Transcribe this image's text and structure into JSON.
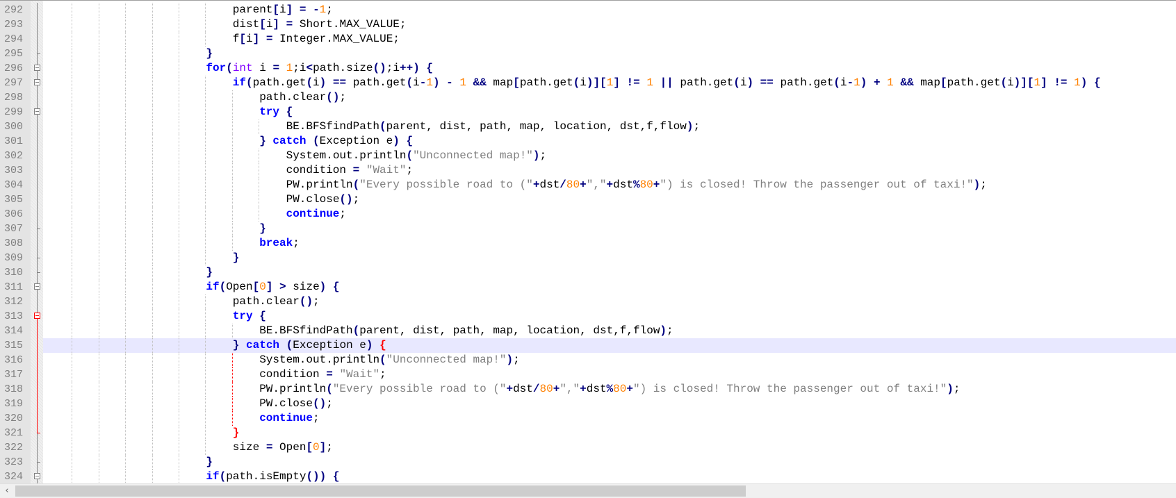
{
  "editor": {
    "current_line": 315,
    "lines": [
      {
        "num": "292",
        "indent": 28,
        "text": "parent[i] = -1;"
      },
      {
        "num": "293",
        "indent": 28,
        "text": "dist[i] = Short.MAX_VALUE;"
      },
      {
        "num": "294",
        "indent": 28,
        "text": "f[i] = Integer.MAX_VALUE;"
      },
      {
        "num": "295",
        "indent": 24,
        "text": "}",
        "fold": "end"
      },
      {
        "num": "296",
        "indent": 24,
        "text": "for(int i = 1;i<path.size();i++) {",
        "fold": "box"
      },
      {
        "num": "297",
        "indent": 28,
        "text": "if(path.get(i) == path.get(i-1) - 1 && map[path.get(i)][1] != 1 || path.get(i) == path.get(i-1) + 1 && map[path.get(i)][1] != 1) {",
        "fold": "box"
      },
      {
        "num": "298",
        "indent": 32,
        "text": "path.clear();"
      },
      {
        "num": "299",
        "indent": 32,
        "text": "try {",
        "fold": "box"
      },
      {
        "num": "300",
        "indent": 36,
        "text": "BE.BFSfindPath(parent, dist, path, map, location, dst,f,flow);"
      },
      {
        "num": "301",
        "indent": 32,
        "text": "} catch (Exception e) {"
      },
      {
        "num": "302",
        "indent": 36,
        "text": "System.out.println(\"Unconnected map!\");"
      },
      {
        "num": "303",
        "indent": 36,
        "text": "condition = \"Wait\";"
      },
      {
        "num": "304",
        "indent": 36,
        "text": "PW.println(\"Every possible road to (\"+dst/80+\",\"+dst%80+\") is closed! Throw the passenger out of taxi!\");"
      },
      {
        "num": "305",
        "indent": 36,
        "text": "PW.close();"
      },
      {
        "num": "306",
        "indent": 36,
        "text": "continue;"
      },
      {
        "num": "307",
        "indent": 32,
        "text": "}",
        "fold": "end"
      },
      {
        "num": "308",
        "indent": 32,
        "text": "break;"
      },
      {
        "num": "309",
        "indent": 28,
        "text": "}",
        "fold": "end"
      },
      {
        "num": "310",
        "indent": 24,
        "text": "}",
        "fold": "end"
      },
      {
        "num": "311",
        "indent": 24,
        "text": "if(Open[0] > size) {",
        "fold": "box"
      },
      {
        "num": "312",
        "indent": 28,
        "text": "path.clear();"
      },
      {
        "num": "313",
        "indent": 28,
        "text": "try {",
        "fold": "box-red"
      },
      {
        "num": "314",
        "indent": 32,
        "text": "BE.BFSfindPath(parent, dist, path, map, location, dst,f,flow);"
      },
      {
        "num": "315",
        "indent": 28,
        "text": "} catch (Exception e) {",
        "match": "last"
      },
      {
        "num": "316",
        "indent": 32,
        "text": "System.out.println(\"Unconnected map!\");"
      },
      {
        "num": "317",
        "indent": 32,
        "text": "condition = \"Wait\";"
      },
      {
        "num": "318",
        "indent": 32,
        "text": "PW.println(\"Every possible road to (\"+dst/80+\",\"+dst%80+\") is closed! Throw the passenger out of taxi!\");"
      },
      {
        "num": "319",
        "indent": 32,
        "text": "PW.close();"
      },
      {
        "num": "320",
        "indent": 32,
        "text": "continue;"
      },
      {
        "num": "321",
        "indent": 28,
        "text": "}",
        "fold": "end-red",
        "match": "first"
      },
      {
        "num": "322",
        "indent": 28,
        "text": "size = Open[0];"
      },
      {
        "num": "323",
        "indent": 24,
        "text": "}",
        "fold": "end"
      },
      {
        "num": "324",
        "indent": 24,
        "text": "if(path.isEmpty()) {",
        "fold": "box"
      }
    ]
  },
  "scrollbar": {
    "left_arrow_icon": "‹",
    "position_fraction": 0.0,
    "visible_fraction": 0.63
  }
}
